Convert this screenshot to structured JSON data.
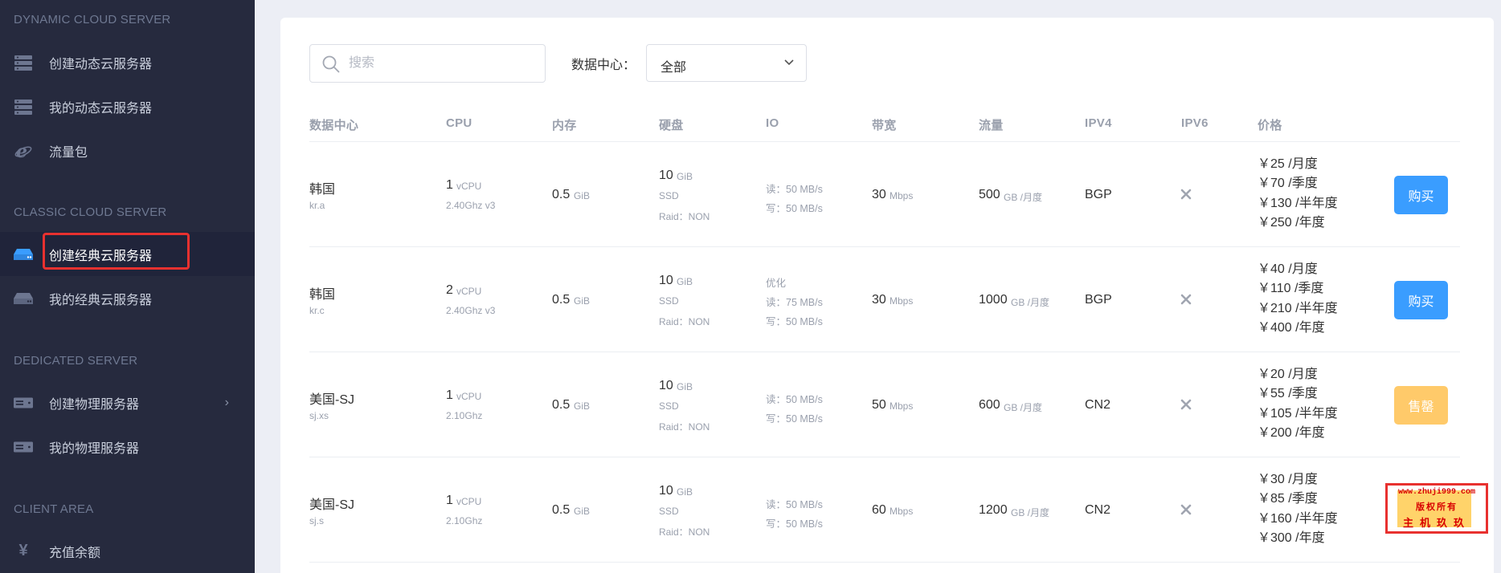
{
  "sidebar": {
    "sections": [
      {
        "title": "DYNAMIC CLOUD SERVER",
        "items": [
          {
            "label": "创建动态云服务器",
            "icon": "server-stack-icon"
          },
          {
            "label": "我的动态云服务器",
            "icon": "server-stack-icon"
          },
          {
            "label": "流量包",
            "icon": "internet-explorer-icon"
          }
        ]
      },
      {
        "title": "CLASSIC CLOUD SERVER",
        "items": [
          {
            "label": "创建经典云服务器",
            "icon": "hard-drive-icon",
            "active": true
          },
          {
            "label": "我的经典云服务器",
            "icon": "hard-drive-icon"
          }
        ]
      },
      {
        "title": "DEDICATED SERVER",
        "items": [
          {
            "label": "创建物理服务器",
            "icon": "rack-server-icon",
            "has_submenu": true
          },
          {
            "label": "我的物理服务器",
            "icon": "rack-server-icon"
          }
        ]
      },
      {
        "title": "CLIENT AREA",
        "items": [
          {
            "label": "充值余额",
            "icon": "yen-icon"
          }
        ]
      }
    ]
  },
  "filters": {
    "search_placeholder": "搜索",
    "search_value": "",
    "datacenter_label": "数据中心：",
    "datacenter_selected": "全部"
  },
  "table": {
    "headers": [
      "数据中心",
      "CPU",
      "内存",
      "硬盘",
      "IO",
      "带宽",
      "流量",
      "IPV4",
      "IPV6",
      "价格"
    ],
    "rows": [
      {
        "dc_name": "韩国",
        "dc_code": "kr.a",
        "cpu_count": "1",
        "cpu_unit": "vCPU",
        "cpu_model": "2.40Ghz v3",
        "mem": "0.5",
        "mem_unit": "GiB",
        "disk": "10",
        "disk_unit": "GiB",
        "disk_type": "SSD",
        "disk_raid": "Raid：NON",
        "io_tag": "",
        "io_read": "读：50 MB/s",
        "io_write": "写：50 MB/s",
        "bw": "30",
        "bw_unit": "Mbps",
        "traffic": "500",
        "traffic_unit": "GB /月度",
        "ipv4": "BGP",
        "ipv6": "none",
        "prices": [
          "￥25 /月度",
          "￥70 /季度",
          "￥130 /半年度",
          "￥250 /年度"
        ],
        "action": "购买",
        "action_state": "available"
      },
      {
        "dc_name": "韩国",
        "dc_code": "kr.c",
        "cpu_count": "2",
        "cpu_unit": "vCPU",
        "cpu_model": "2.40Ghz v3",
        "mem": "0.5",
        "mem_unit": "GiB",
        "disk": "10",
        "disk_unit": "GiB",
        "disk_type": "SSD",
        "disk_raid": "Raid：NON",
        "io_tag": "优化",
        "io_read": "读：75 MB/s",
        "io_write": "写：50 MB/s",
        "bw": "30",
        "bw_unit": "Mbps",
        "traffic": "1000",
        "traffic_unit": "GB /月度",
        "ipv4": "BGP",
        "ipv6": "none",
        "prices": [
          "￥40 /月度",
          "￥110 /季度",
          "￥210 /半年度",
          "￥400 /年度"
        ],
        "action": "购买",
        "action_state": "available"
      },
      {
        "dc_name": "美国-SJ",
        "dc_code": "sj.xs",
        "cpu_count": "1",
        "cpu_unit": "vCPU",
        "cpu_model": "2.10Ghz",
        "mem": "0.5",
        "mem_unit": "GiB",
        "disk": "10",
        "disk_unit": "GiB",
        "disk_type": "SSD",
        "disk_raid": "Raid：NON",
        "io_tag": "",
        "io_read": "读：50 MB/s",
        "io_write": "写：50 MB/s",
        "bw": "50",
        "bw_unit": "Mbps",
        "traffic": "600",
        "traffic_unit": "GB /月度",
        "ipv4": "CN2",
        "ipv6": "none",
        "prices": [
          "￥20 /月度",
          "￥55 /季度",
          "￥105 /半年度",
          "￥200 /年度"
        ],
        "action": "售罄",
        "action_state": "sold-out"
      },
      {
        "dc_name": "美国-SJ",
        "dc_code": "sj.s",
        "cpu_count": "1",
        "cpu_unit": "vCPU",
        "cpu_model": "2.10Ghz",
        "mem": "0.5",
        "mem_unit": "GiB",
        "disk": "10",
        "disk_unit": "GiB",
        "disk_type": "SSD",
        "disk_raid": "Raid：NON",
        "io_tag": "",
        "io_read": "读：50 MB/s",
        "io_write": "写：50 MB/s",
        "bw": "60",
        "bw_unit": "Mbps",
        "traffic": "1200",
        "traffic_unit": "GB /月度",
        "ipv4": "CN2",
        "ipv6": "none",
        "prices": [
          "￥30 /月度",
          "￥85 /季度",
          "￥160 /半年度",
          "￥300 /年度"
        ],
        "action": "",
        "action_state": "obscured"
      }
    ]
  },
  "watermark": {
    "line1": "www.zhuji999.com",
    "line2": "版权所有",
    "line3": "主机玖玖"
  },
  "colors": {
    "sidebar_bg": "#262a3e",
    "button_buy": "#3a9dff",
    "button_soldout": "#ffca6a",
    "highlight_red": "#e8312f"
  }
}
